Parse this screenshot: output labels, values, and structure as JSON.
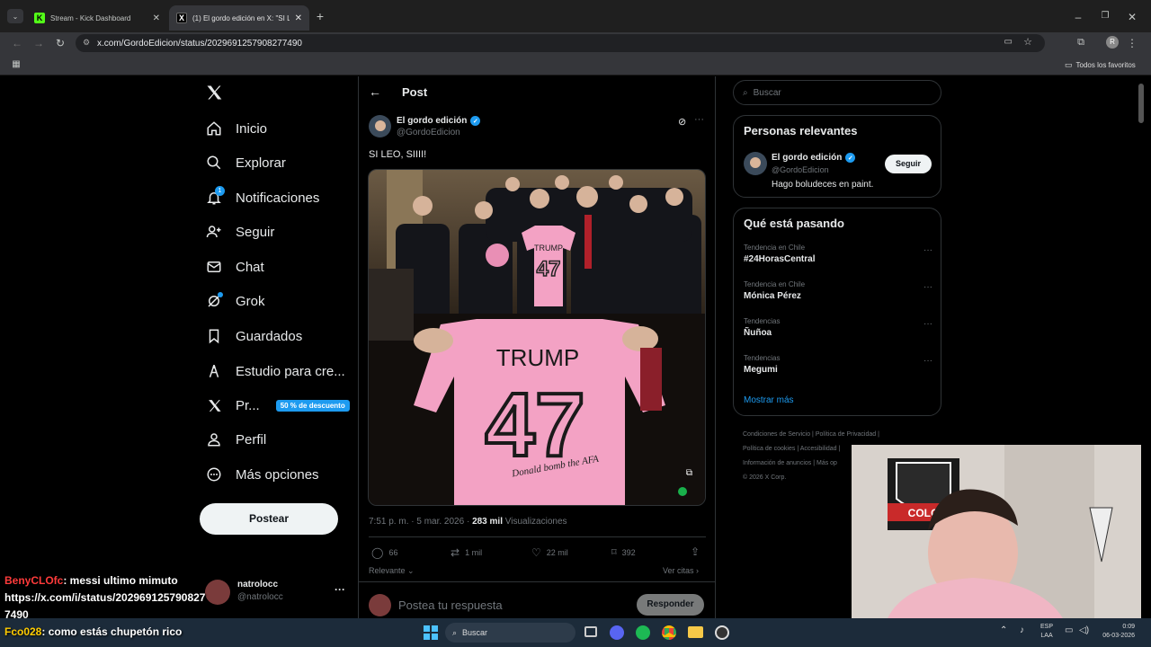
{
  "browser": {
    "tabs": [
      {
        "title": "Stream - Kick Dashboard",
        "active": false
      },
      {
        "title": "(1) El gordo edición en X: \"SI LE",
        "active": true
      }
    ],
    "new_tab": "+",
    "url": "x.com/GordoEdicion/status/2029691257908277490",
    "bookmarks_label": "Todos los favoritos",
    "profile_initial": "R"
  },
  "nav": {
    "items": [
      {
        "label": "Inicio",
        "icon": "home-icon"
      },
      {
        "label": "Explorar",
        "icon": "search-icon"
      },
      {
        "label": "Notificaciones",
        "icon": "bell-icon",
        "badge": "1"
      },
      {
        "label": "Seguir",
        "icon": "add-person-icon"
      },
      {
        "label": "Chat",
        "icon": "mail-icon"
      },
      {
        "label": "Grok",
        "icon": "grok-icon"
      },
      {
        "label": "Guardados",
        "icon": "bookmark-icon"
      },
      {
        "label": "Estudio para cre...",
        "icon": "studio-icon"
      },
      {
        "label": "Pr...",
        "icon": "x-logo-icon",
        "promo": "50 % de descuento"
      },
      {
        "label": "Perfil",
        "icon": "person-icon"
      },
      {
        "label": "Más opciones",
        "icon": "more-circle-icon"
      }
    ],
    "post_button": "Postear",
    "account": {
      "name": "natrolocc",
      "handle": "@natrolocc"
    }
  },
  "post": {
    "header": "Post",
    "author": {
      "name": "El gordo edición",
      "handle": "@GordoEdicion"
    },
    "text": "SI LEO, SIIII!",
    "meta_time": "7:51 p. m. · 5 mar. 2026 · ",
    "views": "283 mil",
    "views_label": " Visualizaciones",
    "stats": {
      "replies": "66",
      "reposts": "1 mil",
      "likes": "22 mil",
      "bookmarks": "392"
    },
    "sort_label": "Relevante",
    "quotes_label": "Ver citas",
    "reply_placeholder": "Postea tu respuesta",
    "reply_button": "Responder",
    "image_jersey_name": "TRUMP",
    "image_jersey_number": "47",
    "image_signature": "Donald bomb the AFA"
  },
  "sidebar": {
    "search_placeholder": "Buscar",
    "relevant_title": "Personas relevantes",
    "relevant_person": {
      "name": "El gordo edición",
      "handle": "@GordoEdicion",
      "bio": "Hago boludeces en paint.",
      "follow": "Seguir"
    },
    "trending_title": "Qué está pasando",
    "trends": [
      {
        "category": "Tendencia en Chile",
        "name": "#24HorasCentral"
      },
      {
        "category": "Tendencia en Chile",
        "name": "Mónica Pérez"
      },
      {
        "category": "Tendencias",
        "name": "Ñuñoa"
      },
      {
        "category": "Tendencias",
        "name": "Megumi"
      }
    ],
    "show_more": "Mostrar más",
    "footer": [
      "Condiciones de Servicio",
      "Política de Privacidad",
      "Política de cookies",
      "Accesibilidad",
      "Información de anuncios",
      "Más op",
      "© 2026 X Corp."
    ]
  },
  "stream_chat": [
    {
      "user": "BenyCLOfc",
      "user_color": "#ff3b3b",
      "msg": ": messi ultimo mimuto"
    },
    {
      "user": "",
      "user_color": "#ffffff",
      "msg": "https://x.com/i/status/202969125790827"
    },
    {
      "user": "",
      "user_color": "#ffffff",
      "msg": "7490"
    },
    {
      "user": "Fco028",
      "user_color": "#ffcc00",
      "msg": ": como estás chupetón rico"
    }
  ],
  "webcam": {
    "flag_text": "COLO"
  },
  "taskbar": {
    "search": "Buscar",
    "lang_top": "ESP",
    "lang_bottom": "LAA",
    "time": "0:09",
    "date": "06-03-2026"
  },
  "colors": {
    "accent": "#1d9bf0",
    "x_bg": "#000000",
    "jersey_pink": "#f3a2c4"
  }
}
